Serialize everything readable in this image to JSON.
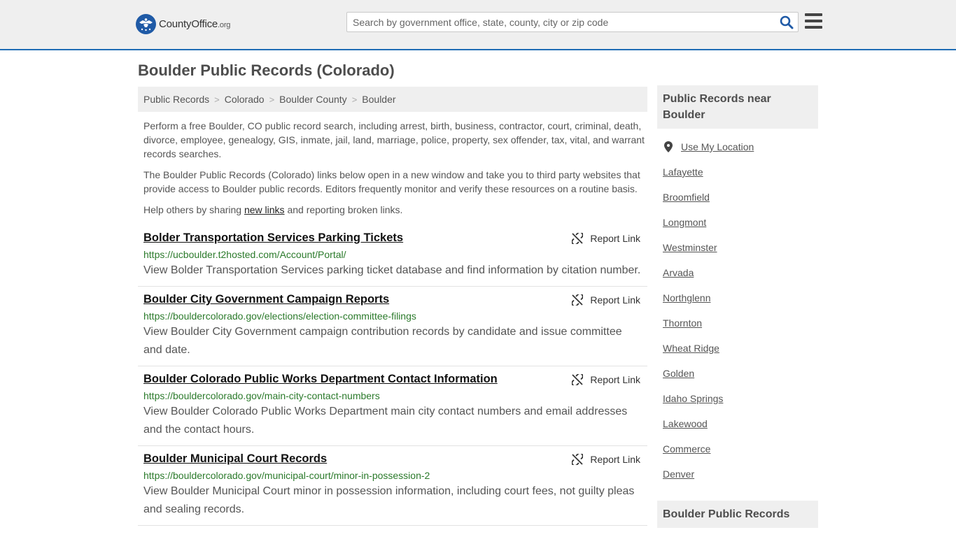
{
  "header": {
    "logo_name": "CountyOffice",
    "logo_tld": ".org",
    "search_placeholder": "Search by government office, state, county, city or zip code",
    "icons": [
      "seal-icon",
      "search-icon",
      "menu-icon"
    ]
  },
  "page": {
    "title": "Boulder Public Records (Colorado)"
  },
  "breadcrumb": [
    "Public Records",
    "Colorado",
    "Boulder County",
    "Boulder"
  ],
  "intro": {
    "p1": "Perform a free Boulder, CO public record search, including arrest, birth, business, contractor, court, criminal, death, divorce, employee, genealogy, GIS, inmate, jail, land, marriage, police, property, sex offender, tax, vital, and warrant records searches.",
    "p2": "The Boulder Public Records (Colorado) links below open in a new window and take you to third party websites that provide access to Boulder public records. Editors frequently monitor and verify these resources on a routine basis.",
    "p3_before": "Help others by sharing ",
    "p3_link": "new links",
    "p3_after": " and reporting broken links."
  },
  "report_label": "Report Link",
  "records": [
    {
      "title": "Bolder Transportation Services Parking Tickets",
      "url": "https://ucboulder.t2hosted.com/Account/Portal/",
      "desc": "View Bolder Transportation Services parking ticket database and find information by citation number."
    },
    {
      "title": "Boulder City Government Campaign Reports",
      "url": "https://bouldercolorado.gov/elections/election-committee-filings",
      "desc": "View Boulder City Government campaign contribution records by candidate and issue committee and date."
    },
    {
      "title": "Boulder Colorado Public Works Department Contact Information",
      "url": "https://bouldercolorado.gov/main-city-contact-numbers",
      "desc": "View Boulder Colorado Public Works Department main city contact numbers and email addresses and the contact hours."
    },
    {
      "title": "Boulder Municipal Court Records",
      "url": "https://bouldercolorado.gov/municipal-court/minor-in-possession-2",
      "desc": "View Boulder Municipal Court minor in possession information, including court fees, not guilty pleas and sealing records."
    }
  ],
  "sidebar": {
    "near_title": "Public Records near Boulder",
    "use_location": "Use My Location",
    "cities": [
      "Lafayette",
      "Broomfield",
      "Longmont",
      "Westminster",
      "Arvada",
      "Northglenn",
      "Thornton",
      "Wheat Ridge",
      "Golden",
      "Idaho Springs",
      "Lakewood",
      "Commerce",
      "Denver"
    ],
    "second_title": "Boulder Public Records"
  },
  "colors": {
    "accent_blue": "#1f6db5",
    "url_green": "#2b7a2b",
    "panel_gray": "#efefef"
  }
}
